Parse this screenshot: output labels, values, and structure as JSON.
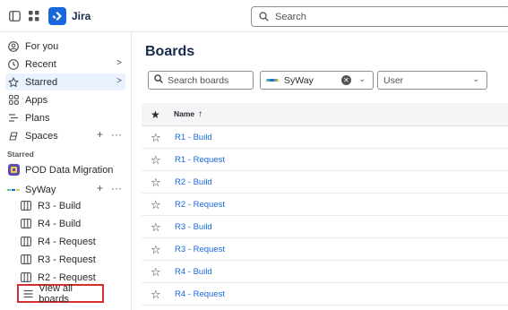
{
  "topbar": {
    "brand": "Jira",
    "search_placeholder": "Search",
    "icons": {
      "sidebar": "sidebar-toggle-icon",
      "apps": "app-switcher-icon",
      "logo": "jira-logo-icon",
      "search": "search-icon"
    }
  },
  "sidebar": {
    "items": [
      {
        "label": "For you",
        "icon": "person-icon"
      },
      {
        "label": "Recent",
        "icon": "clock-icon",
        "chevron": ">"
      },
      {
        "label": "Starred",
        "icon": "star-icon",
        "chevron": ">"
      },
      {
        "label": "Apps",
        "icon": "apps-icon"
      },
      {
        "label": "Plans",
        "icon": "plans-icon"
      },
      {
        "label": "Spaces",
        "icon": "spaces-icon",
        "add": "+",
        "more": "···"
      }
    ],
    "starred_heading": "Starred",
    "spaces": [
      {
        "label": "POD Data Migration",
        "icon": "project-avatar-icon"
      },
      {
        "label": "SyWay",
        "icon": "syway-logo-icon",
        "add": "+",
        "more": "···"
      }
    ],
    "boards": [
      "R3 - Build",
      "R4 - Build",
      "R4 - Request",
      "R3 - Request",
      "R2 - Request"
    ],
    "view_all": "View all boards"
  },
  "main": {
    "title": "Boards",
    "filters": {
      "search_placeholder": "Search boards",
      "space_value": "SyWay",
      "user_placeholder": "User"
    },
    "table": {
      "header_name": "Name",
      "sort_arrow": "↑",
      "rows": [
        "R1 - Build",
        "R1 - Request",
        "R2 - Build",
        "R2 - Request",
        "R3 - Build",
        "R3 - Request",
        "R4 - Build",
        "R4 - Request"
      ]
    }
  },
  "colors": {
    "accent": "#1868db",
    "highlight_border": "#d32f2f",
    "selected_bg": "#e9f2fe"
  }
}
